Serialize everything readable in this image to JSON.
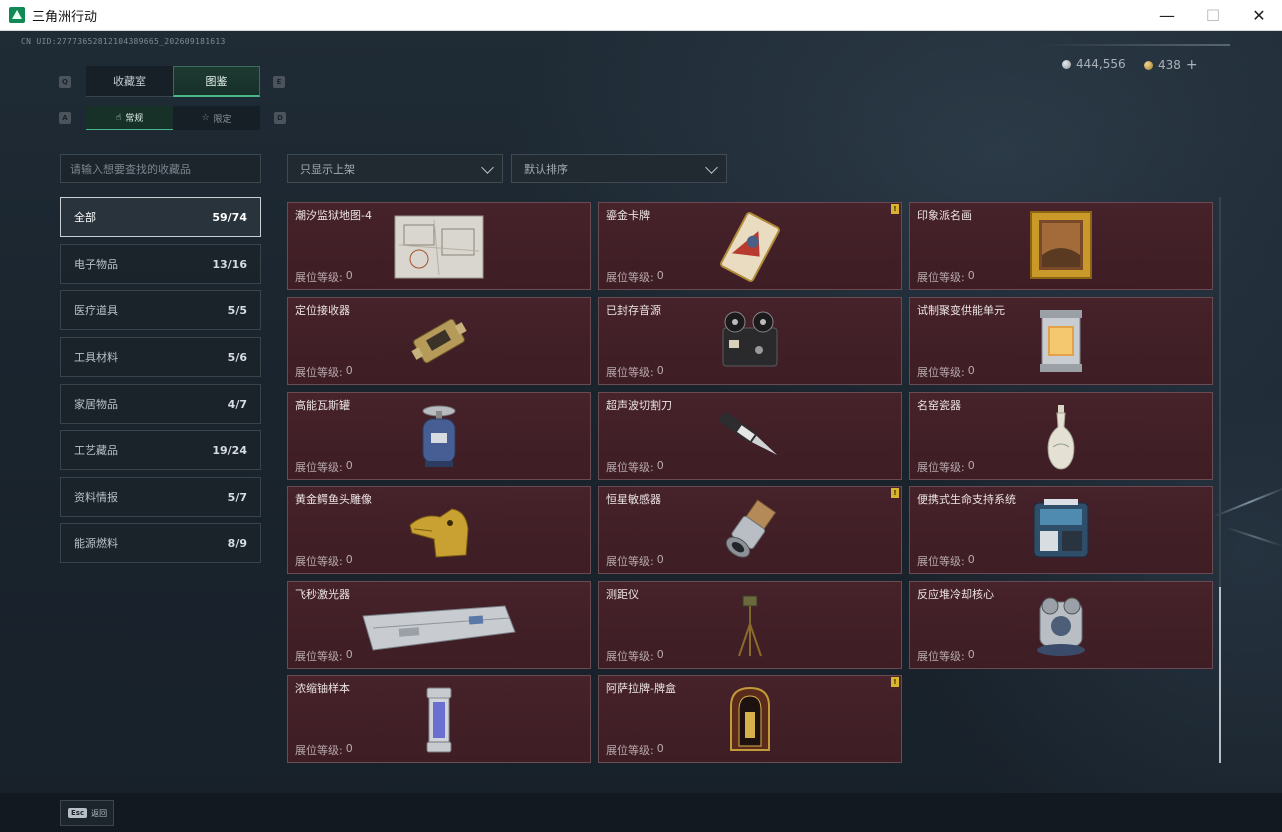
{
  "window": {
    "title": "三角洲行动",
    "minimize": "—",
    "maximize": "☐",
    "close": "✕"
  },
  "uid": "CN UID:27773652812104389665_202609181613",
  "currency": [
    {
      "icon": "silver-coin-icon",
      "value": "444,556"
    },
    {
      "icon": "gold-coin-icon",
      "value": "438",
      "plus": "+"
    }
  ],
  "keys": {
    "prev_tab": "Q",
    "next_tab": "E",
    "prev_sub": "A",
    "next_sub": "D"
  },
  "tabs": [
    {
      "label": "收藏室",
      "active": false
    },
    {
      "label": "图鉴",
      "active": true
    }
  ],
  "subtabs": [
    {
      "label": "常规",
      "icon": "hand-icon",
      "active": true
    },
    {
      "label": "限定",
      "icon": "star-icon",
      "active": false
    }
  ],
  "search": {
    "placeholder": "请输入想要查找的收藏品"
  },
  "filter": {
    "label": "只显示上架"
  },
  "sort": {
    "label": "默认排序"
  },
  "categories": [
    {
      "name": "全部",
      "count": "59/74",
      "active": true
    },
    {
      "name": "电子物品",
      "count": "13/16"
    },
    {
      "name": "医疗道具",
      "count": "5/5"
    },
    {
      "name": "工具材料",
      "count": "5/6"
    },
    {
      "name": "家居物品",
      "count": "4/7"
    },
    {
      "name": "工艺藏品",
      "count": "19/24"
    },
    {
      "name": "资料情报",
      "count": "5/7"
    },
    {
      "name": "能源燃料",
      "count": "8/9"
    }
  ],
  "level_label": "展位等级:",
  "items": [
    {
      "name": "潮汐监狱地图-4",
      "level": "0",
      "icon": "map-icon",
      "badge": ""
    },
    {
      "name": "鎏金卡牌",
      "level": "0",
      "icon": "card-icon",
      "badge": "!"
    },
    {
      "name": "印象派名画",
      "level": "0",
      "icon": "painting-icon",
      "badge": ""
    },
    {
      "name": "定位接收器",
      "level": "0",
      "icon": "receiver-icon",
      "badge": ""
    },
    {
      "name": "已封存音源",
      "level": "0",
      "icon": "tape-recorder-icon",
      "badge": ""
    },
    {
      "name": "试制聚变供能单元",
      "level": "0",
      "icon": "fusion-cell-icon",
      "badge": ""
    },
    {
      "name": "高能瓦斯罐",
      "level": "0",
      "icon": "gas-tank-icon",
      "badge": ""
    },
    {
      "name": "超声波切割刀",
      "level": "0",
      "icon": "knife-icon",
      "badge": ""
    },
    {
      "name": "名窑瓷器",
      "level": "0",
      "icon": "vase-icon",
      "badge": ""
    },
    {
      "name": "黄金鳄鱼头雕像",
      "level": "0",
      "icon": "gold-statue-icon",
      "badge": ""
    },
    {
      "name": "恒星敏感器",
      "level": "0",
      "icon": "star-sensor-icon",
      "badge": "!"
    },
    {
      "name": "便携式生命支持系统",
      "level": "0",
      "icon": "life-support-icon",
      "badge": ""
    },
    {
      "name": "飞秒激光器",
      "level": "0",
      "icon": "laser-icon",
      "badge": ""
    },
    {
      "name": "测距仪",
      "level": "0",
      "icon": "rangefinder-icon",
      "badge": ""
    },
    {
      "name": "反应堆冷却核心",
      "level": "0",
      "icon": "reactor-core-icon",
      "badge": ""
    },
    {
      "name": "浓缩铀样本",
      "level": "0",
      "icon": "uranium-icon",
      "badge": ""
    },
    {
      "name": "阿萨拉牌-牌盒",
      "level": "0",
      "icon": "card-box-icon",
      "badge": "!"
    }
  ],
  "back": {
    "key": "Esc",
    "label": "返回"
  }
}
